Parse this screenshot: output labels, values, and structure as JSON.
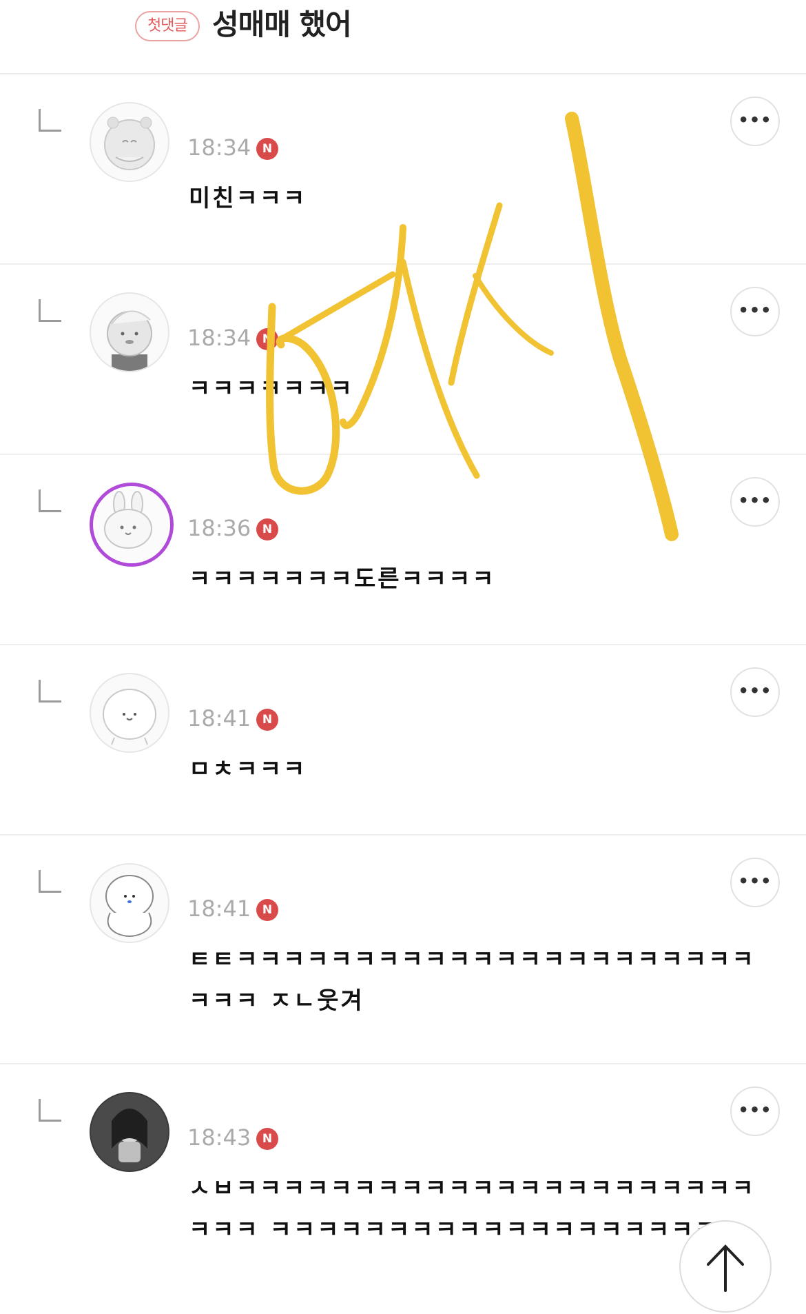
{
  "header": {
    "badge": "첫댓글",
    "title": "성매매 했어"
  },
  "comments": [
    {
      "time": "18:34",
      "new_badge": "N",
      "text": "미친ㅋㅋㅋ",
      "avatar": "hamster-avatar"
    },
    {
      "time": "18:34",
      "new_badge": "N",
      "text": "ㅋㅋㅋㅋㅋㅋㅋ",
      "avatar": "bear-helmet-avatar"
    },
    {
      "time": "18:36",
      "new_badge": "N",
      "text": "ㅋㅋㅋㅋㅋㅋㅋ도른ㅋㅋㅋㅋ",
      "avatar": "bunny-avatar"
    },
    {
      "time": "18:41",
      "new_badge": "N",
      "text": "ㅁㅊㅋㅋㅋ",
      "avatar": "blob-avatar"
    },
    {
      "time": "18:41",
      "new_badge": "N",
      "text": "ㅌㅌㅋㅋㅋㅋㅋㅋㅋㅋㅋㅋㅋㅋㅋㅋㅋㅋㅋㅋㅋㅋㅋㅋㅋㅋㅋ ㅈㄴ웃겨",
      "avatar": "puppy-avatar"
    },
    {
      "time": "18:43",
      "new_badge": "N",
      "text": "ㅅㅂㅋㅋㅋㅋㅋㅋㅋㅋㅋㅋㅋㅋㅋㅋㅋㅋㅋㅋㅋㅋㅋㅋㅋㅋㅋ ㅋㅋㅋㅋㅋㅋㅋㅋㅋㅋㅋㅋㅋㅋㅋㅋㅋㅋㅋㅋ",
      "avatar": "photo-avatar"
    }
  ],
  "more_label": "•••",
  "overlay_scribble": "ㅂㅅ",
  "colors": {
    "accent_red": "#d94a4a",
    "scribble_yellow": "#f1c232",
    "ring_purple": "#b04ad8"
  }
}
